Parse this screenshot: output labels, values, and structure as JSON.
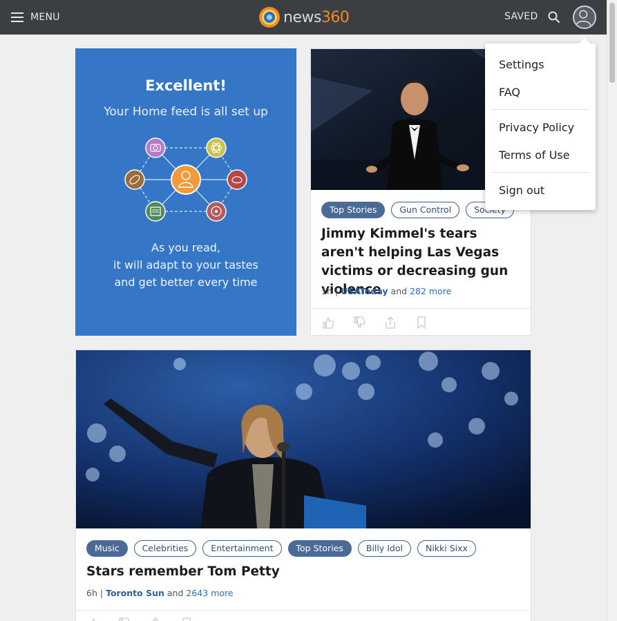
{
  "topbar": {
    "menu_label": "MENU",
    "logo_word": "news",
    "logo_num": "360",
    "saved_label": "SAVED",
    "search_icon": "search-icon",
    "avatar_icon": "user-avatar-icon"
  },
  "welcome": {
    "title": "Excellent!",
    "subtitle": "Your Home feed is all set up",
    "line1": "As you read,",
    "line2": "it will adapt to your tastes",
    "line3": "and get better every time",
    "colors": {
      "bg": "#3577c6",
      "center": "#f39a3a"
    }
  },
  "cards": [
    {
      "tags": [
        {
          "label": "Top Stories",
          "active": true
        },
        {
          "label": "Gun Control",
          "active": false
        },
        {
          "label": "Society",
          "active": false
        }
      ],
      "headline": "Jimmy Kimmel's tears aren't helping Las Vegas victims or decreasing gun violence",
      "time": "1h",
      "sep": "|",
      "source": "USAToday",
      "and": "and",
      "more": "282 more"
    },
    {
      "tags": [
        {
          "label": "Music",
          "active": true
        },
        {
          "label": "Celebrities",
          "active": false
        },
        {
          "label": "Entertainment",
          "active": false
        },
        {
          "label": "Top Stories",
          "active": true
        },
        {
          "label": "Billy Idol",
          "active": false
        },
        {
          "label": "Nikki Sixx",
          "active": false
        }
      ],
      "headline": "Stars remember Tom Petty",
      "time": "6h",
      "sep": "|",
      "source": "Toronto Sun",
      "and": "and",
      "more": "2643 more"
    }
  ],
  "dropdown": {
    "items": [
      "Settings",
      "FAQ",
      "Privacy Policy",
      "Terms of Use",
      "Sign out"
    ]
  }
}
